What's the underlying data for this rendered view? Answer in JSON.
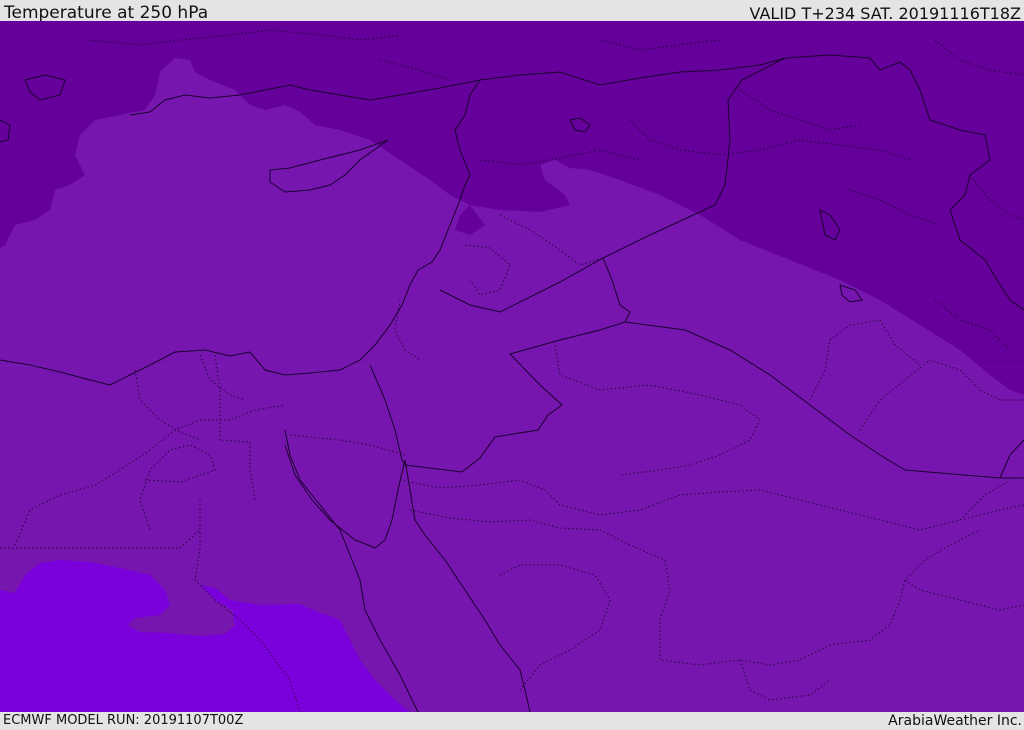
{
  "header": {
    "title": "Temperature at 250 hPa",
    "valid": "VALID T+234 SAT. 20191116T18Z"
  },
  "footer": {
    "model_run": "ECMWF MODEL RUN: 20191107T00Z",
    "credit": "ArabiaWeather Inc."
  },
  "colors": {
    "base": "#7716ae",
    "cold": "#66009a",
    "warm": "#7b01dc",
    "border": "#1a0030",
    "bar_background": "#e4e4e4"
  }
}
